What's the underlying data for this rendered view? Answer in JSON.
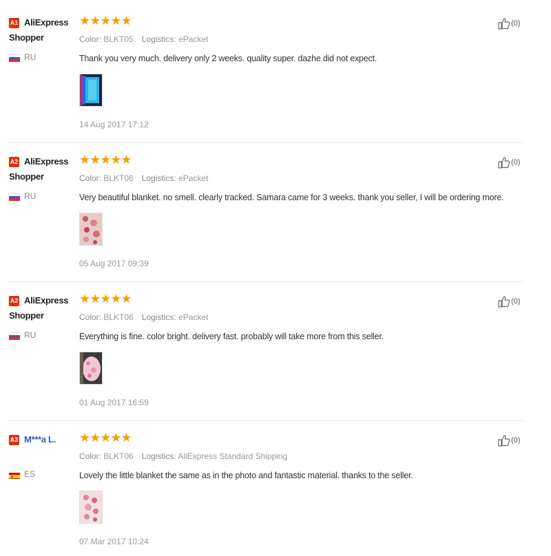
{
  "reviews": [
    {
      "badge": "A1",
      "reviewer": "AliExpress Shopper",
      "country": "RU",
      "flag": "ru",
      "stars": "★★★★★",
      "color_label": "Color:",
      "color": "BLKT05",
      "logistics_label": "Logistics:",
      "logistics": "ePacket",
      "text": "Thank you very much. delivery only 2 weeks. quality super. dazhe did not expect.",
      "date": "14 Aug 2017 17:12",
      "likes": "(0)"
    },
    {
      "badge": "A2",
      "reviewer": "AliExpress Shopper",
      "country": "RU",
      "flag": "ru",
      "stars": "★★★★★",
      "color_label": "Color:",
      "color": "BLKT06",
      "logistics_label": "Logistics:",
      "logistics": "ePacket",
      "text": "Very beautiful blanket. no smell. clearly tracked. Samara came for 3 weeks. thank you seller, I will be ordering more.",
      "date": "05 Aug 2017 09:39",
      "likes": "(0)"
    },
    {
      "badge": "A2",
      "reviewer": "AliExpress Shopper",
      "country": "RU",
      "flag": "ru",
      "stars": "★★★★★",
      "color_label": "Color:",
      "color": "BLKT06",
      "logistics_label": "Logistics:",
      "logistics": "ePacket",
      "text": "Everything is fine. color bright. delivery fast. probably will take more from this seller.",
      "date": "01 Aug 2017 16:59",
      "likes": "(0)"
    },
    {
      "badge": "A3",
      "reviewer": "M***a L.",
      "country": "ES",
      "flag": "es",
      "stars": "★★★★★",
      "color_label": "Color:",
      "color": "BLKT06",
      "logistics_label": "Logistics:",
      "logistics": "AliExpress Standard Shipping",
      "text": "Lovely the little blanket the same as in the photo and fantastic material. thanks to the seller.",
      "date": "07 Mar 2017 10:24",
      "likes": "(0)"
    }
  ],
  "icons": {
    "like": "thumbs-up-icon"
  },
  "colors": {
    "star": "#f6a000",
    "badge": "#e62e04",
    "link": "#2a5fc1"
  }
}
